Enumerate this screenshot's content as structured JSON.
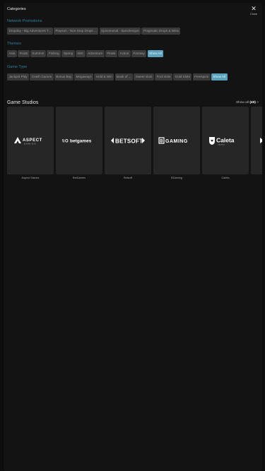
{
  "header": {
    "title": "Categories",
    "close_label": "Close"
  },
  "sections": {
    "network_promotions": {
      "title": "Network Promotions",
      "chips": [
        "Dropday - Big Adventures T...",
        "Playson - Non-Stop Drops ...",
        "Spinomenal - Spinolesque",
        "Pragmatic Drops & Wins"
      ]
    },
    "themes": {
      "title": "Themes",
      "chips": [
        "Asia",
        "Fruits",
        "Summer",
        "Fishing",
        "Spring",
        "Irish",
        "Adventure",
        "Pirate",
        "Action",
        "Fantasy"
      ],
      "show_all": "Show All"
    },
    "game_type": {
      "title": "Game Type",
      "chips": [
        "Jackpot Play",
        "Crash Games",
        "Bonus Buy",
        "Megaways",
        "Hold & Win",
        "Book of ...",
        "Sweet slots",
        "Fruit slots",
        "Gold Slots",
        "Freespins"
      ],
      "show_all": "Show All"
    }
  },
  "studios": {
    "title": "Game Studios",
    "show_all_prefix": "Show all",
    "show_all_count": "(40)",
    "show_all_arrow": ">",
    "cards": [
      {
        "name": "Aspect Games",
        "logo": "ASPECT GAMING"
      },
      {
        "name": "BetGames",
        "logo": "betgames"
      },
      {
        "name": "Betsoft",
        "logo": "BETSOFT"
      },
      {
        "name": "BGaming",
        "logo": "BGAMING"
      },
      {
        "name": "Caleta",
        "logo": "Caleta"
      }
    ]
  },
  "colors": {
    "background": "#0d0d0d",
    "panel": "#131313",
    "chip": "#3a3a3a",
    "accent": "#5ca2bd",
    "section_title": "#2f7fa0"
  }
}
